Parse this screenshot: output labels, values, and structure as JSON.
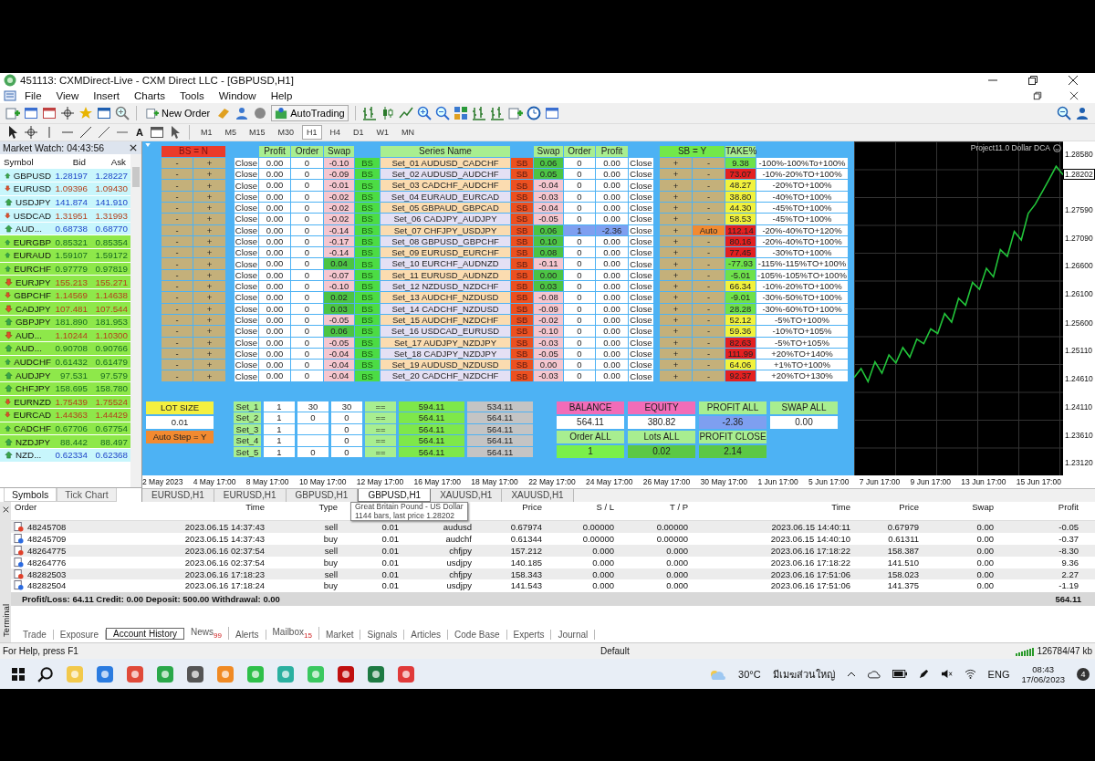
{
  "window": {
    "title": "451113: CXMDirect-Live - CXM Direct LLC - [GBPUSD,H1]"
  },
  "menu": [
    "File",
    "View",
    "Insert",
    "Charts",
    "Tools",
    "Window",
    "Help"
  ],
  "toolbar": {
    "new_order": "New Order",
    "auto_trading": "AutoTrading",
    "text_tool": "A",
    "timeframes": [
      {
        "label": "M1",
        "selected": false
      },
      {
        "label": "M5",
        "selected": false
      },
      {
        "label": "M15",
        "selected": false
      },
      {
        "label": "M30",
        "selected": false
      },
      {
        "label": "H1",
        "selected": true
      },
      {
        "label": "H4",
        "selected": false
      },
      {
        "label": "D1",
        "selected": false
      },
      {
        "label": "W1",
        "selected": false
      },
      {
        "label": "MN",
        "selected": false
      }
    ]
  },
  "market_watch": {
    "title": "Market Watch: 04:43:56",
    "columns": [
      "Symbol",
      "Bid",
      "Ask"
    ],
    "rows": [
      {
        "symbol": "GBPUSD",
        "bid": "1.28197",
        "ask": "1.28227",
        "rising": true,
        "highlight": false
      },
      {
        "symbol": "EURUSD",
        "bid": "1.09396",
        "ask": "1.09430",
        "rising": false,
        "highlight": false
      },
      {
        "symbol": "USDJPY",
        "bid": "141.874",
        "ask": "141.910",
        "rising": true,
        "highlight": false
      },
      {
        "symbol": "USDCAD",
        "bid": "1.31951",
        "ask": "1.31993",
        "rising": false,
        "highlight": false
      },
      {
        "symbol": "AUD...",
        "bid": "0.68738",
        "ask": "0.68770",
        "rising": true,
        "highlight": false
      },
      {
        "symbol": "EURGBP",
        "bid": "0.85321",
        "ask": "0.85354",
        "rising": true,
        "highlight": true
      },
      {
        "symbol": "EURAUD",
        "bid": "1.59107",
        "ask": "1.59172",
        "rising": true,
        "highlight": true
      },
      {
        "symbol": "EURCHF",
        "bid": "0.97779",
        "ask": "0.97819",
        "rising": true,
        "highlight": true
      },
      {
        "symbol": "EURJPY",
        "bid": "155.213",
        "ask": "155.271",
        "rising": false,
        "highlight": true
      },
      {
        "symbol": "GBPCHF",
        "bid": "1.14569",
        "ask": "1.14638",
        "rising": false,
        "highlight": true
      },
      {
        "symbol": "CADJPY",
        "bid": "107.481",
        "ask": "107.544",
        "rising": false,
        "highlight": true
      },
      {
        "symbol": "GBPJPY",
        "bid": "181.890",
        "ask": "181.953",
        "rising": true,
        "highlight": true
      },
      {
        "symbol": "AUD...",
        "bid": "1.10244",
        "ask": "1.10300",
        "rising": false,
        "highlight": true
      },
      {
        "symbol": "AUD...",
        "bid": "0.90708",
        "ask": "0.90766",
        "rising": true,
        "highlight": true
      },
      {
        "symbol": "AUDCHF",
        "bid": "0.61432",
        "ask": "0.61479",
        "rising": true,
        "highlight": true
      },
      {
        "symbol": "AUDJPY",
        "bid": "97.531",
        "ask": "97.579",
        "rising": true,
        "highlight": true
      },
      {
        "symbol": "CHFJPY",
        "bid": "158.695",
        "ask": "158.780",
        "rising": true,
        "highlight": true
      },
      {
        "symbol": "EURNZD",
        "bid": "1.75439",
        "ask": "1.75524",
        "rising": false,
        "highlight": true
      },
      {
        "symbol": "EURCAD",
        "bid": "1.44363",
        "ask": "1.44429",
        "rising": false,
        "highlight": true
      },
      {
        "symbol": "CADCHF",
        "bid": "0.67706",
        "ask": "0.67754",
        "rising": true,
        "highlight": true
      },
      {
        "symbol": "NZDJPY",
        "bid": "88.442",
        "ask": "88.497",
        "rising": true,
        "highlight": true
      },
      {
        "symbol": "NZD...",
        "bid": "0.62334",
        "ask": "0.62368",
        "rising": true,
        "highlight": false
      }
    ],
    "tabs": [
      {
        "label": "Symbols",
        "selected": true
      },
      {
        "label": "Tick Chart",
        "selected": false
      }
    ]
  },
  "panel": {
    "bs_header": "BS = N",
    "sb_header": "SB = Y",
    "bs_columns": [
      "Profit",
      "Order",
      "Swap"
    ],
    "series_header": "Series Name",
    "sb_columns": [
      "Swap",
      "Order",
      "Profit"
    ],
    "take_header": "TAKE%",
    "rows": [
      {
        "minus": "-",
        "plus": "+",
        "close": "Close",
        "profit": "0.00",
        "order": "0",
        "swap": {
          "text": "-0.10",
          "color": "#f5c6cf"
        },
        "bs": "BS",
        "series": "Set_01 AUDUSD_CADCHF",
        "sb": "SB",
        "sb_swap": {
          "text": "0.06",
          "color": "#4cc444"
        },
        "sb_order": "0",
        "sb_profit": "0.00",
        "sb_active": false,
        "sb_close": "Close",
        "sb_plus": "+",
        "sb_minus": "-",
        "sb_auto": false,
        "take": {
          "text": "9.38",
          "color": "#6ee24a"
        },
        "target": "-100%-100%To+100%"
      },
      {
        "minus": "-",
        "plus": "+",
        "close": "Close",
        "profit": "0.00",
        "order": "0",
        "swap": {
          "text": "-0.09",
          "color": "#f5c6cf"
        },
        "bs": "BS",
        "series": "Set_02 AUDUSD_AUDCHF",
        "sb": "SB",
        "sb_swap": {
          "text": "0.05",
          "color": "#4cc444"
        },
        "sb_order": "0",
        "sb_profit": "0.00",
        "sb_active": false,
        "sb_close": "Close",
        "sb_plus": "+",
        "sb_minus": "-",
        "sb_auto": false,
        "take": {
          "text": "73.07",
          "color": "#e42020"
        },
        "target": "-10%-20%TO+100%"
      },
      {
        "minus": "-",
        "plus": "+",
        "close": "Close",
        "profit": "0.00",
        "order": "0",
        "swap": {
          "text": "-0.01",
          "color": "#f5c6cf"
        },
        "bs": "BS",
        "series": "Set_03 CADCHF_AUDCHF",
        "sb": "SB",
        "sb_swap": {
          "text": "-0.04",
          "color": "#f5c6cf"
        },
        "sb_order": "0",
        "sb_profit": "0.00",
        "sb_active": false,
        "sb_close": "Close",
        "sb_plus": "+",
        "sb_minus": "-",
        "sb_auto": false,
        "take": {
          "text": "48.27",
          "color": "#f2f23c"
        },
        "target": "-20%TO+100%"
      },
      {
        "minus": "-",
        "plus": "+",
        "close": "Close",
        "profit": "0.00",
        "order": "0",
        "swap": {
          "text": "-0.02",
          "color": "#f5c6cf"
        },
        "bs": "BS",
        "series": "Set_04 EURAUD_EURCAD",
        "sb": "SB",
        "sb_swap": {
          "text": "-0.03",
          "color": "#f5c6cf"
        },
        "sb_order": "0",
        "sb_profit": "0.00",
        "sb_active": false,
        "sb_close": "Close",
        "sb_plus": "+",
        "sb_minus": "-",
        "sb_auto": false,
        "take": {
          "text": "38.80",
          "color": "#f2f23c"
        },
        "target": "-40%TO+100%"
      },
      {
        "minus": "-",
        "plus": "+",
        "close": "Close",
        "profit": "0.00",
        "order": "0",
        "swap": {
          "text": "-0.02",
          "color": "#f5c6cf"
        },
        "bs": "BS",
        "series": "Set_05 GBPAUD_GBPCAD",
        "sb": "SB",
        "sb_swap": {
          "text": "-0.04",
          "color": "#f5c6cf"
        },
        "sb_order": "0",
        "sb_profit": "0.00",
        "sb_active": false,
        "sb_close": "Close",
        "sb_plus": "+",
        "sb_minus": "-",
        "sb_auto": false,
        "take": {
          "text": "44.30",
          "color": "#f2f23c"
        },
        "target": "-45%TO+100%"
      },
      {
        "minus": "-",
        "plus": "+",
        "close": "Close",
        "profit": "0.00",
        "order": "0",
        "swap": {
          "text": "-0.02",
          "color": "#f5c6cf"
        },
        "bs": "BS",
        "series": "Set_06 CADJPY_AUDJPY",
        "sb": "SB",
        "sb_swap": {
          "text": "-0.05",
          "color": "#f5c6cf"
        },
        "sb_order": "0",
        "sb_profit": "0.00",
        "sb_active": false,
        "sb_close": "Close",
        "sb_plus": "+",
        "sb_minus": "-",
        "sb_auto": false,
        "take": {
          "text": "58.53",
          "color": "#f2f23c"
        },
        "target": "-45%TO+100%"
      },
      {
        "minus": "-",
        "plus": "+",
        "close": "Close",
        "profit": "0.00",
        "order": "0",
        "swap": {
          "text": "-0.14",
          "color": "#f5c6cf"
        },
        "bs": "BS",
        "series": "Set_07 CHFJPY_USDJPY",
        "sb": "SB",
        "sb_swap": {
          "text": "0.06",
          "color": "#4cc444"
        },
        "sb_order": "1",
        "sb_profit": "-2.36",
        "sb_active": true,
        "sb_close": "Close",
        "sb_plus": "+",
        "sb_minus": "Auto",
        "sb_auto": true,
        "take": {
          "text": "112.14",
          "color": "#e42020"
        },
        "target": "-20%-40%TO+120%"
      },
      {
        "minus": "-",
        "plus": "+",
        "close": "Close",
        "profit": "0.00",
        "order": "0",
        "swap": {
          "text": "-0.17",
          "color": "#f5c6cf"
        },
        "bs": "BS",
        "series": "Set_08 GBPUSD_GBPCHF",
        "sb": "SB",
        "sb_swap": {
          "text": "0.10",
          "color": "#4cc444"
        },
        "sb_order": "0",
        "sb_profit": "0.00",
        "sb_active": false,
        "sb_close": "Close",
        "sb_plus": "+",
        "sb_minus": "-",
        "sb_auto": false,
        "take": {
          "text": "80.16",
          "color": "#e42020"
        },
        "target": "-20%-40%TO+100%"
      },
      {
        "minus": "-",
        "plus": "+",
        "close": "Close",
        "profit": "0.00",
        "order": "0",
        "swap": {
          "text": "-0.14",
          "color": "#f5c6cf"
        },
        "bs": "BS",
        "series": "Set_09 EURUSD_EURCHF",
        "sb": "SB",
        "sb_swap": {
          "text": "0.08",
          "color": "#4cc444"
        },
        "sb_order": "0",
        "sb_profit": "0.00",
        "sb_active": false,
        "sb_close": "Close",
        "sb_plus": "+",
        "sb_minus": "-",
        "sb_auto": false,
        "take": {
          "text": "77.45",
          "color": "#e42020"
        },
        "target": "-30%TO+100%"
      },
      {
        "minus": "-",
        "plus": "+",
        "close": "Close",
        "profit": "0.00",
        "order": "0",
        "swap": {
          "text": "0.04",
          "color": "#4cc444"
        },
        "bs": "BS",
        "series": "Set_10 EURCHF_AUDNZD",
        "sb": "SB",
        "sb_swap": {
          "text": "-0.11",
          "color": "#f5c6cf"
        },
        "sb_order": "0",
        "sb_profit": "0.00",
        "sb_active": false,
        "sb_close": "Close",
        "sb_plus": "+",
        "sb_minus": "-",
        "sb_auto": false,
        "take": {
          "text": "-77.93",
          "color": "#6ee24a"
        },
        "target": "-115%-115%TO+100%"
      },
      {
        "minus": "-",
        "plus": "+",
        "close": "Close",
        "profit": "0.00",
        "order": "0",
        "swap": {
          "text": "-0.07",
          "color": "#f5c6cf"
        },
        "bs": "BS",
        "series": "Set_11 EURUSD_AUDNZD",
        "sb": "SB",
        "sb_swap": {
          "text": "0.00",
          "color": "#4cc444"
        },
        "sb_order": "0",
        "sb_profit": "0.00",
        "sb_active": false,
        "sb_close": "Close",
        "sb_plus": "+",
        "sb_minus": "-",
        "sb_auto": false,
        "take": {
          "text": "-5.01",
          "color": "#6ee24a"
        },
        "target": "-105%-105%TO+100%"
      },
      {
        "minus": "-",
        "plus": "+",
        "close": "Close",
        "profit": "0.00",
        "order": "0",
        "swap": {
          "text": "-0.10",
          "color": "#f5c6cf"
        },
        "bs": "BS",
        "series": "Set_12 NZDUSD_NZDCHF",
        "sb": "SB",
        "sb_swap": {
          "text": "0.03",
          "color": "#4cc444"
        },
        "sb_order": "0",
        "sb_profit": "0.00",
        "sb_active": false,
        "sb_close": "Close",
        "sb_plus": "+",
        "sb_minus": "-",
        "sb_auto": false,
        "take": {
          "text": "66.34",
          "color": "#f2f23c"
        },
        "target": "-10%-20%TO+100%"
      },
      {
        "minus": "-",
        "plus": "+",
        "close": "Close",
        "profit": "0.00",
        "order": "0",
        "swap": {
          "text": "0.02",
          "color": "#4cc444"
        },
        "bs": "BS",
        "series": "Set_13 AUDCHF_NZDUSD",
        "sb": "SB",
        "sb_swap": {
          "text": "-0.08",
          "color": "#f5c6cf"
        },
        "sb_order": "0",
        "sb_profit": "0.00",
        "sb_active": false,
        "sb_close": "Close",
        "sb_plus": "+",
        "sb_minus": "-",
        "sb_auto": false,
        "take": {
          "text": "-9.01",
          "color": "#6ee24a"
        },
        "target": "-30%-50%TO+100%"
      },
      {
        "minus": "-",
        "plus": "+",
        "close": "Close",
        "profit": "0.00",
        "order": "0",
        "swap": {
          "text": "0.03",
          "color": "#4cc444"
        },
        "bs": "BS",
        "series": "Set_14 CADCHF_NZDUSD",
        "sb": "SB",
        "sb_swap": {
          "text": "-0.09",
          "color": "#f5c6cf"
        },
        "sb_order": "0",
        "sb_profit": "0.00",
        "sb_active": false,
        "sb_close": "Close",
        "sb_plus": "+",
        "sb_minus": "-",
        "sb_auto": false,
        "take": {
          "text": "28.28",
          "color": "#6ee24a"
        },
        "target": "-30%-60%TO+100%"
      },
      {
        "minus": "-",
        "plus": "+",
        "close": "Close",
        "profit": "0.00",
        "order": "0",
        "swap": {
          "text": "-0.05",
          "color": "#f5c6cf"
        },
        "bs": "BS",
        "series": "Set_15 AUDCHF_NZDCHF",
        "sb": "SB",
        "sb_swap": {
          "text": "-0.02",
          "color": "#f5c6cf"
        },
        "sb_order": "0",
        "sb_profit": "0.00",
        "sb_active": false,
        "sb_close": "Close",
        "sb_plus": "+",
        "sb_minus": "-",
        "sb_auto": false,
        "take": {
          "text": "52.12",
          "color": "#f2f23c"
        },
        "target": "-5%TO+100%"
      },
      {
        "minus": "-",
        "plus": "+",
        "close": "Close",
        "profit": "0.00",
        "order": "0",
        "swap": {
          "text": "0.06",
          "color": "#4cc444"
        },
        "bs": "BS",
        "series": "Set_16 USDCAD_EURUSD",
        "sb": "SB",
        "sb_swap": {
          "text": "-0.10",
          "color": "#f5c6cf"
        },
        "sb_order": "0",
        "sb_profit": "0.00",
        "sb_active": false,
        "sb_close": "Close",
        "sb_plus": "+",
        "sb_minus": "-",
        "sb_auto": false,
        "take": {
          "text": "59.36",
          "color": "#f2f23c"
        },
        "target": "-10%TO+105%"
      },
      {
        "minus": "-",
        "plus": "+",
        "close": "Close",
        "profit": "0.00",
        "order": "0",
        "swap": {
          "text": "-0.05",
          "color": "#f5c6cf"
        },
        "bs": "BS",
        "series": "Set_17 AUDJPY_NZDJPY",
        "sb": "SB",
        "sb_swap": {
          "text": "-0.03",
          "color": "#f5c6cf"
        },
        "sb_order": "0",
        "sb_profit": "0.00",
        "sb_active": false,
        "sb_close": "Close",
        "sb_plus": "+",
        "sb_minus": "-",
        "sb_auto": false,
        "take": {
          "text": "82.63",
          "color": "#e42020"
        },
        "target": "-5%TO+105%"
      },
      {
        "minus": "-",
        "plus": "+",
        "close": "Close",
        "profit": "0.00",
        "order": "0",
        "swap": {
          "text": "-0.04",
          "color": "#f5c6cf"
        },
        "bs": "BS",
        "series": "Set_18 CADJPY_NZDJPY",
        "sb": "SB",
        "sb_swap": {
          "text": "-0.05",
          "color": "#f5c6cf"
        },
        "sb_order": "0",
        "sb_profit": "0.00",
        "sb_active": false,
        "sb_close": "Close",
        "sb_plus": "+",
        "sb_minus": "-",
        "sb_auto": false,
        "take": {
          "text": "111.99",
          "color": "#e42020"
        },
        "target": "+20%TO+140%"
      },
      {
        "minus": "-",
        "plus": "+",
        "close": "Close",
        "profit": "0.00",
        "order": "0",
        "swap": {
          "text": "-0.04",
          "color": "#f5c6cf"
        },
        "bs": "BS",
        "series": "Set_19 AUDUSD_NZDUSD",
        "sb": "SB",
        "sb_swap": {
          "text": "0.00",
          "color": "#f5c6cf"
        },
        "sb_order": "0",
        "sb_profit": "0.00",
        "sb_active": false,
        "sb_close": "Close",
        "sb_plus": "+",
        "sb_minus": "-",
        "sb_auto": false,
        "take": {
          "text": "64.06",
          "color": "#f2f23c"
        },
        "target": "+1%TO+100%"
      },
      {
        "minus": "-",
        "plus": "+",
        "close": "Close",
        "profit": "0.00",
        "order": "0",
        "swap": {
          "text": "-0.04",
          "color": "#f5c6cf"
        },
        "bs": "BS",
        "series": "Set_20 CADCHF_NZDCHF",
        "sb": "SB",
        "sb_swap": {
          "text": "-0.03",
          "color": "#f5c6cf"
        },
        "sb_order": "0",
        "sb_profit": "0.00",
        "sb_active": false,
        "sb_close": "Close",
        "sb_plus": "+",
        "sb_minus": "-",
        "sb_auto": false,
        "take": {
          "text": "92.37",
          "color": "#e42020"
        },
        "target": "+20%TO+130%"
      }
    ],
    "lot_size": {
      "label": "LOT SIZE",
      "value": "0.01",
      "auto_step": "Auto Step = Y"
    },
    "sets": [
      {
        "name": "Set_1",
        "c1": "1",
        "c2": "30",
        "c3": "30",
        "op": "==",
        "v1": "594.11",
        "v2": "534.11"
      },
      {
        "name": "Set_2",
        "c1": "1",
        "c2": "0",
        "c3": "0",
        "op": "==",
        "v1": "564.11",
        "v2": "564.11"
      },
      {
        "name": "Set_3",
        "c1": "1",
        "c3": "0",
        "op": "==",
        "v1": "564.11",
        "v2": "564.11"
      },
      {
        "name": "Set_4",
        "c1": "1",
        "c3": "0",
        "op": "==",
        "v1": "564.11",
        "v2": "564.11"
      },
      {
        "name": "Set_5",
        "c1": "1",
        "c2": "0",
        "c3": "0",
        "op": "==",
        "v1": "564.11",
        "v2": "564.11"
      }
    ],
    "summary": [
      {
        "label": {
          "text": "BALANCE",
          "color": "#f26cb8"
        },
        "value": {
          "text": "564.11",
          "color": "#ffffff"
        }
      },
      {
        "label": {
          "text": "EQUITY",
          "color": "#f26cb8"
        },
        "value": {
          "text": "380.82",
          "color": "#ffffff"
        }
      },
      {
        "label": {
          "text": "PROFIT ALL",
          "color": "#a8ee90"
        },
        "value": {
          "text": "-2.36",
          "color": "#7e9ff0"
        }
      },
      {
        "label": {
          "text": "SWAP ALL",
          "color": "#a8ee90"
        },
        "value": {
          "text": "0.00",
          "color": "#ffffff"
        }
      },
      {
        "label": {
          "text": "Order ALL",
          "color": "#a8ee90"
        },
        "value": {
          "text": "1",
          "color": "#7af04a"
        }
      },
      {
        "label": {
          "text": "Lots ALL",
          "color": "#a8ee90"
        },
        "value": {
          "text": "0.02",
          "color": "#5cc844"
        }
      },
      {
        "label": {
          "text": "PROFIT CLOSE",
          "color": "#a8ee90"
        },
        "value": {
          "text": "2.14",
          "color": "#5cc844"
        }
      }
    ]
  },
  "chart": {
    "indicator": "Project11.0 Dollar DCA",
    "current_price": "1.28202",
    "chart_data": {
      "type": "line",
      "ylim": [
        1.2291,
        1.2879
      ],
      "yticks": [
        {
          "value": 1.2858,
          "label": "1.28580"
        },
        {
          "value": 1.2759,
          "label": "1.27590"
        },
        {
          "value": 1.2709,
          "label": "1.27090"
        },
        {
          "value": 1.266,
          "label": "1.26600"
        },
        {
          "value": 1.261,
          "label": "1.26100"
        },
        {
          "value": 1.256,
          "label": "1.25600"
        },
        {
          "value": 1.2511,
          "label": "1.25110"
        },
        {
          "value": 1.2461,
          "label": "1.24610"
        },
        {
          "value": 1.2411,
          "label": "1.24110"
        },
        {
          "value": 1.2361,
          "label": "1.23610"
        },
        {
          "value": 1.2312,
          "label": "1.23120"
        }
      ],
      "series": [
        {
          "color": "#22c43a",
          "values": [
            1.2462,
            1.2478,
            1.2455,
            1.249,
            1.247,
            1.2502,
            1.2488,
            1.2515,
            1.2498,
            1.253,
            1.2522,
            1.2548,
            1.254,
            1.2575,
            1.256,
            1.2602,
            1.259,
            1.263,
            1.2618,
            1.2655,
            1.264,
            1.2688,
            1.2676,
            1.272,
            1.2705,
            1.2752,
            1.2768,
            1.279,
            1.2812,
            1.2835,
            1.282
          ]
        }
      ]
    },
    "date_axis": [
      "2 May 2023",
      "4 May 17:00",
      "8 May 17:00",
      "10 May 17:00",
      "12 May 17:00",
      "16 May 17:00",
      "18 May 17:00",
      "22 May 17:00",
      "24 May 17:00",
      "26 May 17:00",
      "30 May 17:00",
      "1 Jun 17:00",
      "5 Jun 17:00",
      "7 Jun 17:00",
      "9 Jun 17:00",
      "13 Jun 17:00",
      "15 Jun 17:00"
    ],
    "tabs": [
      {
        "label": "EURUSD,H1",
        "selected": false
      },
      {
        "label": "EURUSD,H1",
        "selected": false
      },
      {
        "label": "GBPUSD,H1",
        "selected": false
      },
      {
        "label": "GBPUSD,H1",
        "selected": true
      },
      {
        "label": "XAUUSD,H1",
        "selected": false
      },
      {
        "label": "XAUUSD,H1",
        "selected": false
      }
    ],
    "tooltip": [
      "Great Britain Pound - US Dollar",
      "1144 bars, last price 1.28202"
    ]
  },
  "terminal": {
    "label": "Terminal",
    "columns": [
      "Order",
      "Time",
      "Type",
      "",
      "",
      "Price",
      "S / L",
      "T / P",
      "Time",
      "Price",
      "Swap",
      "Profit"
    ],
    "rows": [
      {
        "kind": "sell",
        "cells": [
          "48245708",
          "2023.06.15 14:37:43",
          "sell",
          "0.01",
          "audusd",
          "0.67974",
          "0.00000",
          "0.00000",
          "2023.06.15 14:40:11",
          "0.67979",
          "0.00",
          "-0.05"
        ]
      },
      {
        "kind": "buy",
        "cells": [
          "48245709",
          "2023.06.15 14:37:43",
          "buy",
          "0.01",
          "audchf",
          "0.61344",
          "0.00000",
          "0.00000",
          "2023.06.15 14:40:10",
          "0.61311",
          "0.00",
          "-0.37"
        ]
      },
      {
        "kind": "sell",
        "cells": [
          "48264775",
          "2023.06.16 02:37:54",
          "sell",
          "0.01",
          "chfjpy",
          "157.212",
          "0.000",
          "0.000",
          "2023.06.16 17:18:22",
          "158.387",
          "0.00",
          "-8.30"
        ]
      },
      {
        "kind": "buy",
        "cells": [
          "48264776",
          "2023.06.16 02:37:54",
          "buy",
          "0.01",
          "usdjpy",
          "140.185",
          "0.000",
          "0.000",
          "2023.06.16 17:18:22",
          "141.510",
          "0.00",
          "9.36"
        ]
      },
      {
        "kind": "sell",
        "cells": [
          "48282503",
          "2023.06.16 17:18:23",
          "sell",
          "0.01",
          "chfjpy",
          "158.343",
          "0.000",
          "0.000",
          "2023.06.16 17:51:06",
          "158.023",
          "0.00",
          "2.27"
        ]
      },
      {
        "kind": "buy",
        "cells": [
          "48282504",
          "2023.06.16 17:18:24",
          "buy",
          "0.01",
          "usdjpy",
          "141.543",
          "0.000",
          "0.000",
          "2023.06.16 17:51:06",
          "141.375",
          "0.00",
          "-1.19"
        ]
      }
    ],
    "summary": "Profit/Loss: 64.11  Credit: 0.00  Deposit: 500.00  Withdrawal: 0.00",
    "total": "564.11",
    "tabs": [
      {
        "label": "Trade",
        "selected": false
      },
      {
        "label": "Exposure",
        "selected": false
      },
      {
        "label": "Account History",
        "selected": true
      },
      {
        "label": "News",
        "badge": "99",
        "selected": false
      },
      {
        "label": "Alerts",
        "selected": false
      },
      {
        "label": "Mailbox",
        "badge": "15",
        "selected": false
      },
      {
        "label": "Market",
        "selected": false
      },
      {
        "label": "Signals",
        "selected": false
      },
      {
        "label": "Articles",
        "selected": false
      },
      {
        "label": "Code Base",
        "selected": false
      },
      {
        "label": "Experts",
        "selected": false
      },
      {
        "label": "Journal",
        "selected": false
      }
    ]
  },
  "status_bar": {
    "help": "For Help, press F1",
    "profile": "Default",
    "traffic": "126784/47 kb"
  },
  "taskbar": {
    "temperature": "30°C",
    "weather": "มีเมฆส่วนใหญ่",
    "language": "ENG",
    "time": "08:43",
    "date": "17/06/2023",
    "notifications": "4"
  }
}
